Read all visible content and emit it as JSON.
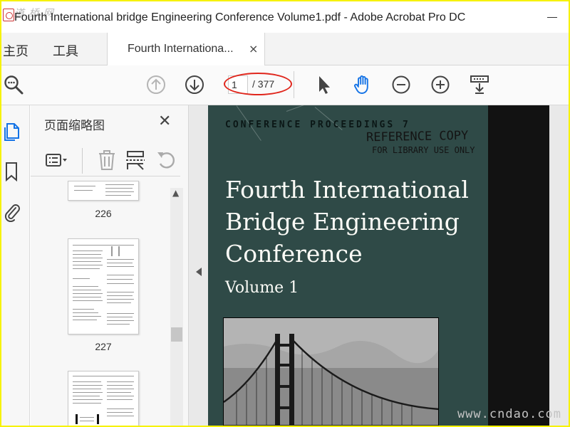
{
  "window": {
    "title": "Fourth International bridge Engineering Conference Volume1.pdf - Adobe Acrobat Pro DC",
    "watermark_top": "道 桥 网"
  },
  "menu": {
    "home": "主页",
    "tools": "工具"
  },
  "tab": {
    "label": "Fourth Internationa...",
    "close": "×"
  },
  "toolbar": {
    "page_current": "1",
    "page_total": "/ 377"
  },
  "thumbnails_panel": {
    "title": "页面缩略图",
    "close": "✕",
    "pages": [
      {
        "label": "226"
      },
      {
        "label": "227"
      },
      {
        "label": ""
      }
    ]
  },
  "document": {
    "series": "CONFERENCE PROCEEDINGS 7",
    "stamp_line1": "REFERENCE COPY",
    "stamp_line2": "FOR LIBRARY USE ONLY",
    "title_lines": [
      "Fourth International",
      "Bridge Engineering",
      "Conference"
    ],
    "volume": "Volume 1"
  },
  "watermark_bottom": "www.cndao.com",
  "colors": {
    "accent_blue": "#1473e6",
    "annotation_red": "#e0261c",
    "cover_green": "#2f4a47",
    "border_yellow": "#f6f200"
  },
  "icons": {
    "search": "search-icon",
    "prev_page": "arrow-up-circle-icon",
    "next_page": "arrow-down-circle-icon",
    "select": "pointer-arrow-icon",
    "hand": "hand-icon",
    "zoom_out": "minus-circle-icon",
    "zoom_in": "plus-circle-icon",
    "more_tools": "scroll-mode-icon"
  }
}
